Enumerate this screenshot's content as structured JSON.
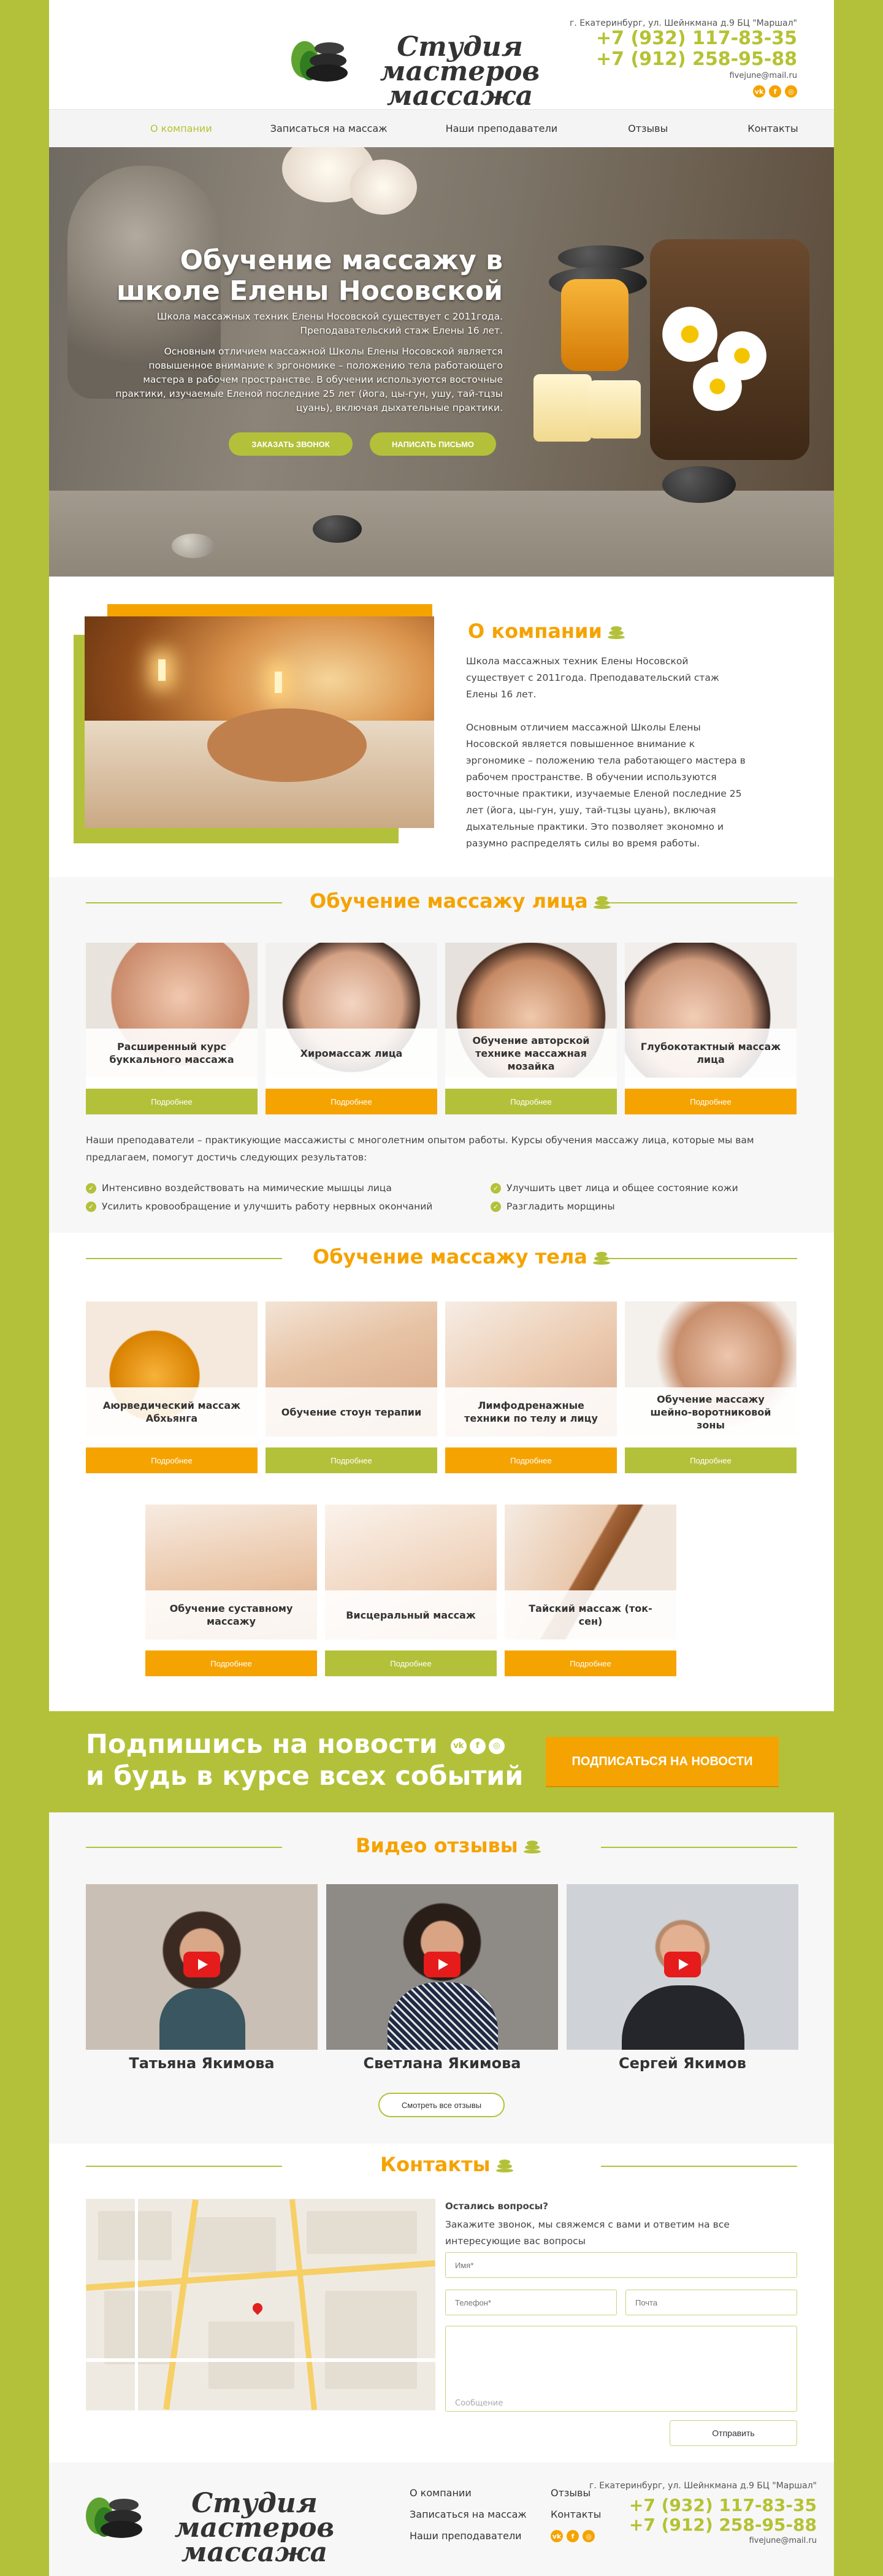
{
  "header": {
    "logo_line1": "Студия мастеров",
    "logo_line2": "массажа",
    "address": "г. Екатеринбург, ул. Шейнкмана д.9 БЦ \"Маршал\"",
    "phone1": "+7 (932) 117-83-35",
    "phone2": "+7 (912) 258-95-88",
    "email": "fivejune@mail.ru",
    "socials": [
      "vk-icon",
      "facebook-icon",
      "instagram-icon"
    ]
  },
  "nav": {
    "items": [
      "О компании",
      "Записаться на массаж",
      "Наши преподаватели",
      "Отзывы",
      "Контакты"
    ]
  },
  "hero": {
    "title": "Обучение массажу в школе Елены Носовской",
    "text1": "Школа массажных техник Елены Носовской существует с 2011года. Преподавательский стаж Елены 16 лет.",
    "text2": "Основным отличием массажной Школы Елены Носовской является повышенное внимание к эргономике – положению тела работающего мастера в рабочем пространстве. В обучении используются восточные практики, изучаемые Еленой последние 25 лет (йога, цы-гун, ушу, тай-тцзы цуань), включая дыхательные практики.",
    "btn_call": "ЗАКАЗАТЬ ЗВОНОК",
    "btn_write": "НАПИСАТЬ ПИСЬМО"
  },
  "about": {
    "title": "О компании",
    "p1": "Школа массажных техник Елены Носовской существует с 2011года. Преподавательский стаж Елены 16 лет.",
    "p2": "Основным отличием массажной Школы Елены Носовской является повышенное внимание к эргономике – положению тела работающего мастера в рабочем пространстве. В обучении используются восточные практики, изучаемые Еленой последние 25 лет (йога, цы-гун, ушу, тай-тцзы цуань), включая дыхательные практики. Это позволяет экономно и разумно распределять силы во время работы."
  },
  "face": {
    "title": "Обучение массажу лица",
    "cards": [
      {
        "label": "Расширенный курс буккального массажа",
        "button": "Подробнее"
      },
      {
        "label": "Хиромассаж лица",
        "button": "Подробнее"
      },
      {
        "label": "Обучение авторской технике массажная мозайка",
        "button": "Подробнее"
      },
      {
        "label": "Глубокотактный массаж лица",
        "button": "Подробнее"
      }
    ],
    "intro": "Наши преподаватели – практикующие массажисты с многолетним опытом работы. Курсы обучения массажу лица, которые мы вам предлагаем, помогут достичь следующих результатов:",
    "bullets": [
      "Интенсивно воздействовать на мимические мышцы лица",
      "Усилить кровообращение и улучшить работу нервных окончаний",
      "Улучшить цвет лица и общее состояние кожи",
      "Разгладить морщины"
    ]
  },
  "body": {
    "title": "Обучение массажу тела",
    "cards": [
      {
        "label": "Аюрведический массаж Абхьянга",
        "button": "Подробнее"
      },
      {
        "label": "Обучение стоун терапии",
        "button": "Подробнее"
      },
      {
        "label": "Лимфодренажные техники по телу и лицу",
        "button": "Подробнее"
      },
      {
        "label": "Обучение массажу шейно-воротниковой зоны",
        "button": "Подробнее"
      },
      {
        "label": "Обучение суставному массажу",
        "button": "Подробнее"
      },
      {
        "label": "Висцеральный массаж",
        "button": "Подробнее"
      },
      {
        "label": "Тайский массаж (ток-сен)",
        "button": "Подробнее"
      }
    ]
  },
  "subscribe": {
    "line1": "Подпишись на новости",
    "line2": "и будь в курсе всех событий",
    "button": "ПОДПИСАТЬСЯ НА НОВОСТИ"
  },
  "videos": {
    "title": "Видео отзывы",
    "items": [
      {
        "name": "Татьяна  Якимова"
      },
      {
        "name": "Светлана  Якимова"
      },
      {
        "name": "Сергей  Якимов"
      }
    ],
    "button": "Смотреть все отзывы"
  },
  "contacts": {
    "title": "Контакты",
    "q": "Остались вопросы?",
    "desc": "Закажите звонок, мы свяжемся с вами и ответим на все интересующие вас вопросы",
    "name_ph": "Имя*",
    "phone_ph": "Телефон*",
    "email_ph": "Почта",
    "msg_ph": "Сообщение",
    "send": "Отправить"
  },
  "footer": {
    "links_col1": [
      "О компании",
      "Записаться на массаж",
      "Наши преподаватели"
    ],
    "links_col2": [
      "Отзывы",
      "Контакты"
    ]
  },
  "colors": {
    "accent": "#b3c13a",
    "orange": "#f5a300"
  }
}
